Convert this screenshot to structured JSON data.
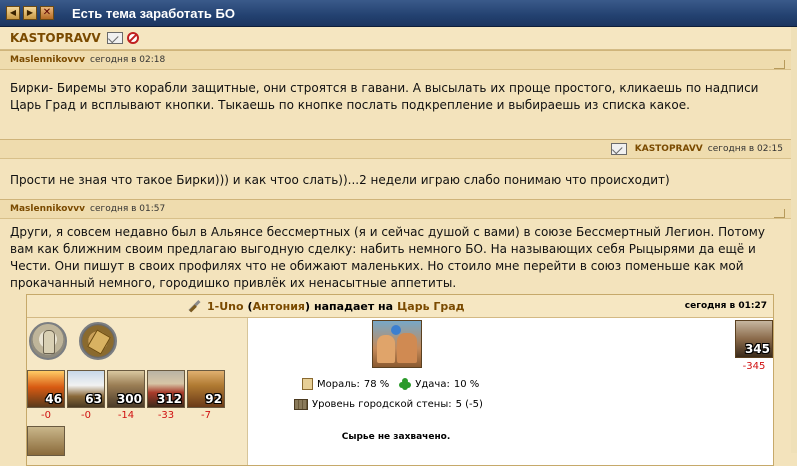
{
  "window": {
    "title": "Есть тема заработать БО",
    "buttons": [
      "prev",
      "next",
      "close"
    ],
    "btn_glyphs": {
      "prev": "◀",
      "next": "▶",
      "close": "✕"
    }
  },
  "thread_author": {
    "name": "KASTOPRAVV",
    "icons": [
      "mail-icon",
      "block-icon"
    ]
  },
  "posts": [
    {
      "author": "Maslennikovvv",
      "time": "сегодня в 02:18",
      "text": "Бирки- Биремы это корабли защитные, они строятся в гавани. А высылать их проще простого, кликаешь по надписи Царь Град и всплывают кнопки. Тыкаешь по кнопке послать подкрепление и выбираешь из списка какое."
    },
    {
      "author": "KASTOPRAVV",
      "time": "сегодня в 02:15",
      "text": "Прости не зная что такое Бирки))) и как чтоо слать))...2 недели играю слабо понимаю что происходит)"
    },
    {
      "author": "Maslennikovvv",
      "time": "сегодня в 01:57",
      "text": "Други, я совсем недавно был в Альянсе бессмертных (я и сейчас душой с вами) в союзе Бессмертный Легион. Потому вам как ближним своим предлагаю выгодную сделку: набить немного БО. На называющих себя Рыцырями да ещё и Чести. Они пишут в своих профилях что не обижают маленьких. Но стоило мне перейти в союз поменьше как мой прокачанный немного, городишко привлёк их ненасытные аппетиты."
    }
  ],
  "report": {
    "attacker_city": "1-Uno",
    "attacker_player": "Антония",
    "paren_open": "(",
    "paren_close": ")",
    "action": "нападает на",
    "target_city": "Царь Град",
    "time": "сегодня в 01:27",
    "attacker_units": [
      {
        "count": "46",
        "loss": "-0"
      },
      {
        "count": "63",
        "loss": "-0"
      },
      {
        "count": "300",
        "loss": "-14"
      },
      {
        "count": "312",
        "loss": "-33"
      },
      {
        "count": "92",
        "loss": "-7"
      }
    ],
    "morale_label": "Мораль:",
    "morale_value": "78 %",
    "luck_label": "Удача:",
    "luck_value": "10 %",
    "wall_label": "Уровень городской стены:",
    "wall_value": "5 (-5)",
    "captured_text": "Сырье не захвачено.",
    "defender": {
      "count": "345",
      "loss": "-345"
    }
  }
}
